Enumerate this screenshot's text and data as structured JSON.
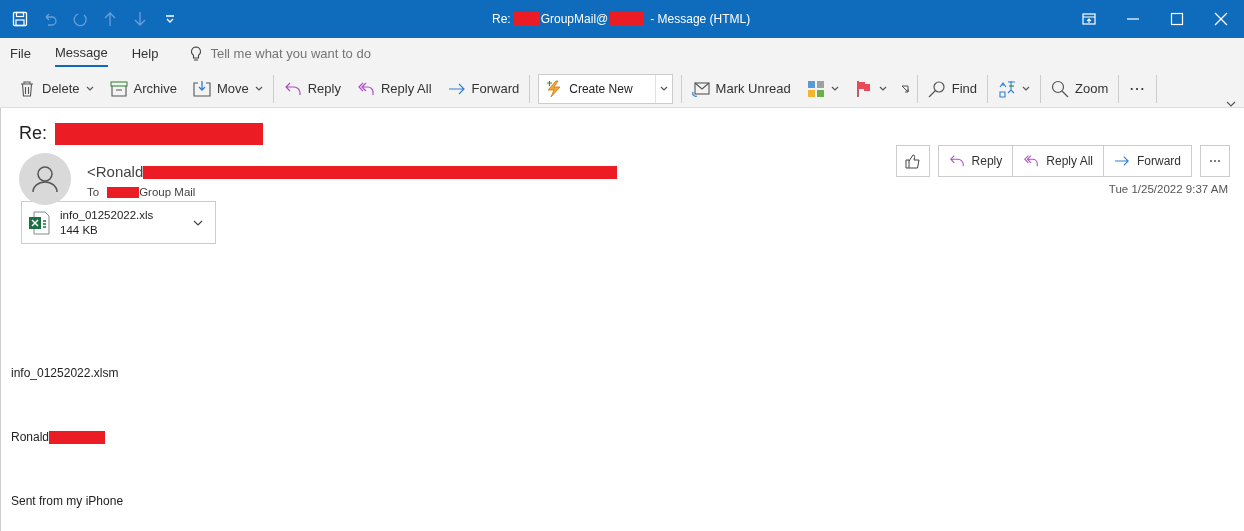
{
  "window": {
    "title_parts": [
      "Re:",
      "GroupMail@",
      "- Message (HTML)"
    ]
  },
  "menu": [
    {
      "label": "File",
      "selected": false
    },
    {
      "label": "Message",
      "selected": true
    },
    {
      "label": "Help",
      "selected": false
    }
  ],
  "tell_me": {
    "placeholder": "Tell me what you want to do"
  },
  "ribbon": [
    [
      {
        "label": "Delete",
        "dropdown": true
      },
      {
        "label": "Archive",
        "dropdown": false
      },
      {
        "label": "Move",
        "dropdown": true
      }
    ],
    [
      {
        "label": "Reply",
        "dropdown": false
      },
      {
        "label": "Reply All",
        "dropdown": false
      },
      {
        "label": "Forward",
        "dropdown": false
      }
    ],
    [
      {
        "label": "Create New",
        "dropdown": true
      }
    ],
    [
      {
        "label": "Mark Unread",
        "dropdown": false
      },
      {
        "dropdown": true
      },
      {
        "dropdown": true
      }
    ],
    [
      {
        "label": "Find",
        "dropdown": false
      }
    ],
    [
      {
        "dropdown": true
      }
    ],
    [
      {
        "label": "Zoom",
        "dropdown": false
      }
    ],
    [
      {
        "label": "⋯",
        "dropdown": false
      }
    ]
  ],
  "message": {
    "subject": "Re:",
    "sender": "<Ronald",
    "to_label": "To",
    "to": "Group Mail",
    "actions": [
      "Reply",
      "Reply All",
      "Forward"
    ],
    "more": "⋯",
    "date": "Tue 1/25/2022 9:37 AM",
    "attachment": {
      "name": "info_01252022.xls",
      "size": "144 KB"
    },
    "body": [
      "info_01252022.xlsm",
      "Ronald",
      "Sent from my iPhone"
    ]
  }
}
